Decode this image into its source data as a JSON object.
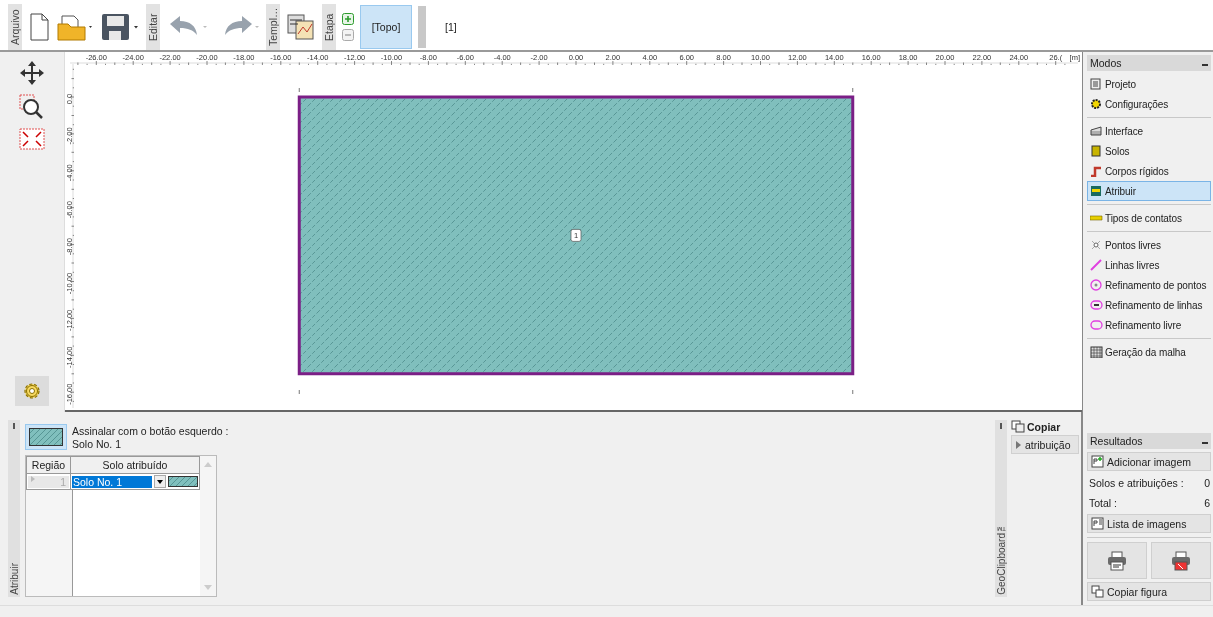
{
  "toolbar": {
    "sections": [
      "Arquivo",
      "Editar",
      "Templ…",
      "Etapa"
    ],
    "stages": [
      {
        "label": "[Topo]",
        "selected": true
      },
      {
        "label": "[1]",
        "selected": false
      }
    ]
  },
  "canvas": {
    "x_labels": [
      "-26.00",
      "-24.00",
      "-22.00",
      "-20.00",
      "-18.00",
      "-16.00",
      "-14.00",
      "-12.00",
      "-10.00",
      "-8.00",
      "-6.00",
      "-4.00",
      "-2.00",
      "0.00",
      "2.00",
      "4.00",
      "6.00",
      "8.00",
      "10.00",
      "12.00",
      "14.00",
      "16.00",
      "18.00",
      "20.00",
      "22.00",
      "24.00",
      "26.("
    ],
    "unit": "[m]",
    "y_labels": [
      "0.0",
      "-2.00",
      "-4.00",
      "-6.00",
      "-8.00",
      "-10.00",
      "-12.00",
      "-14.00",
      "-16.00"
    ],
    "regions": [
      {
        "label": "1"
      }
    ]
  },
  "modes": {
    "title": "Modos",
    "groups": [
      [
        {
          "label": "Projeto",
          "selected": false
        },
        {
          "label": "Configurações",
          "selected": false
        }
      ],
      [
        {
          "label": "Interface",
          "selected": false
        },
        {
          "label": "Solos",
          "selected": false
        },
        {
          "label": "Corpos rígidos",
          "selected": false
        },
        {
          "label": "Atribuir",
          "selected": true
        }
      ],
      [
        {
          "label": "Tipos de contatos",
          "selected": false
        }
      ],
      [
        {
          "label": "Pontos livres",
          "selected": false
        },
        {
          "label": "Linhas livres",
          "selected": false
        },
        {
          "label": "Refinamento de pontos",
          "selected": false
        },
        {
          "label": "Refinamento de linhas",
          "selected": false
        },
        {
          "label": "Refinamento livre",
          "selected": false
        }
      ],
      [
        {
          "label": "Geração da malha",
          "selected": false
        }
      ]
    ]
  },
  "assign": {
    "side_label": "Atribuir",
    "prompt": "Assinalar com o botão esquerdo :",
    "current": "Solo No. 1",
    "table": {
      "columns": [
        "Região",
        "Solo atribuído"
      ],
      "rows": [
        {
          "region": "1",
          "soil": "Solo No. 1",
          "selected": true
        }
      ]
    }
  },
  "clipboard": {
    "side_label": "GeoClipboard™",
    "title": "Copiar",
    "buttons": [
      "atribuição"
    ]
  },
  "results": {
    "title": "Resultados",
    "add_button": "Adicionar imagem",
    "stats": [
      {
        "label": "Solos e atribuições :",
        "value": "0"
      },
      {
        "label": "Total :",
        "value": "6"
      }
    ],
    "list_button": "Lista de imagens",
    "copy_button": "Copiar figura"
  }
}
